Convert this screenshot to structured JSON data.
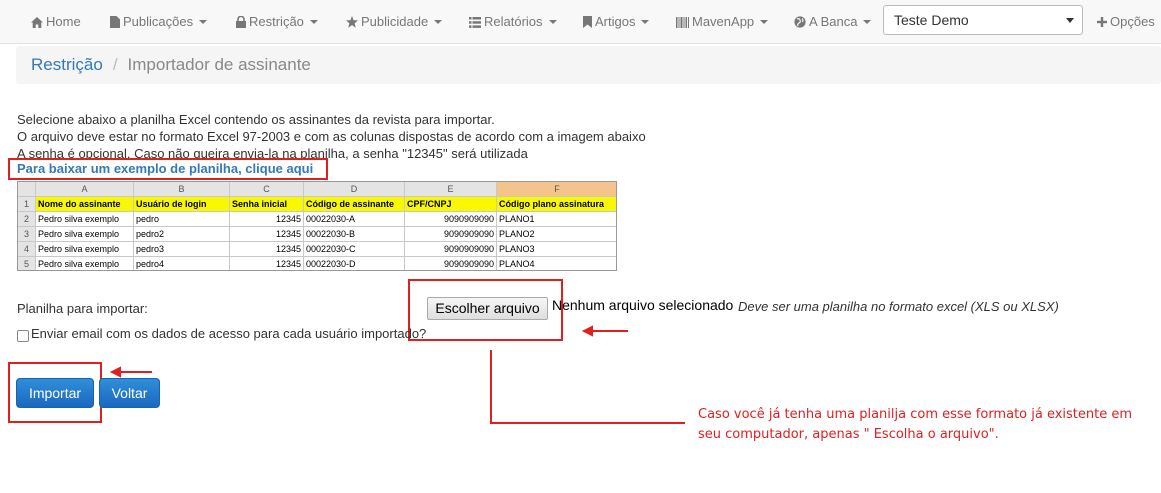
{
  "nav": {
    "items": [
      {
        "label": "Home",
        "icon": "home-icon",
        "has_caret": false
      },
      {
        "label": "Publicações",
        "icon": "file-icon",
        "has_caret": true
      },
      {
        "label": "Restrição",
        "icon": "lock-icon",
        "has_caret": true
      },
      {
        "label": "Publicidade",
        "icon": "star-icon",
        "has_caret": true
      },
      {
        "label": "Relatórios",
        "icon": "list-icon",
        "has_caret": true
      },
      {
        "label": "Artigos",
        "icon": "bookmark-icon",
        "has_caret": true
      },
      {
        "label": "MavenApp",
        "icon": "barcode-icon",
        "has_caret": true
      },
      {
        "label": "A Banca",
        "icon": "globe-icon",
        "has_caret": true
      }
    ],
    "account_select": "Teste Demo",
    "options_label": "Opções"
  },
  "breadcrumb": {
    "parent": "Restrição",
    "separator": "/",
    "current": "Importador de assinante"
  },
  "instructions": {
    "line1": "Selecione abaixo a planilha Excel contendo os assinantes da revista para importar.",
    "line2": "O arquivo deve estar no formato Excel 97-2003 e com as colunas dispostas de acordo com a imagem abaixo",
    "line3": "A senha é opcional. Caso não queira envia-la na planilha, a senha \"12345\" será utilizada"
  },
  "download_link": "Para baixar um exemplo de planilha, clique aqui",
  "sheet": {
    "column_letters": [
      "A",
      "B",
      "C",
      "D",
      "E",
      "F"
    ],
    "headers": [
      "Nome do assinante",
      "Usuário de login",
      "Senha inicial",
      "Código de assinante",
      "CPF/CNPJ",
      "Código plano assinatura"
    ],
    "rows": [
      [
        "Pedro silva exemplo",
        "pedro",
        "12345",
        "00022030-A",
        "9090909090",
        "PLANO1"
      ],
      [
        "Pedro silva exemplo",
        "pedro2",
        "12345",
        "00022030-B",
        "9090909090",
        "PLANO2"
      ],
      [
        "Pedro silva exemplo",
        "pedro3",
        "12345",
        "00022030-C",
        "9090909090",
        "PLANO3"
      ],
      [
        "Pedro silva exemplo",
        "pedro4",
        "12345",
        "00022030-D",
        "9090909090",
        "PLANO4"
      ]
    ],
    "row_numbers": [
      "1",
      "2",
      "3",
      "4",
      "5"
    ]
  },
  "form": {
    "file_label": "Planilha para importar:",
    "file_button": "Escolher arquivo",
    "no_file_text": "Nenhum arquivo selecionado",
    "file_hint": "Deve ser uma planilha no formato excel (XLS ou XLSX)",
    "email_checkbox_label": "Enviar email com os dados de acesso para cada usuário importado?",
    "import_button": "Importar",
    "back_button": "Voltar"
  },
  "annotation": {
    "line1": "Caso você já tenha uma planilja com esse formato já existente em",
    "line2": "seu computador, apenas \" Escolha o arquivo\"."
  },
  "colors": {
    "annotation_red": "#e02020",
    "link_blue": "#337ab7",
    "button_blue": "#1a68c0",
    "sheet_header_yellow": "#f8f800"
  }
}
